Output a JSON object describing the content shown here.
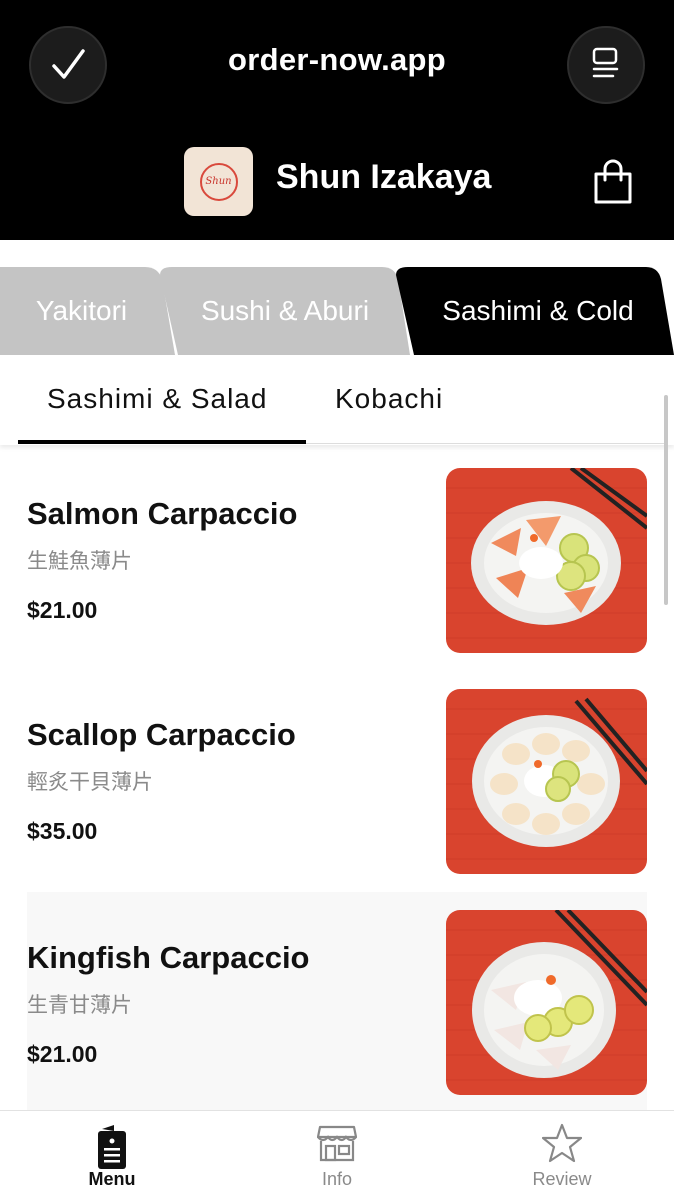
{
  "header": {
    "url": "order-now.app",
    "logo_text": "Shun",
    "store_name": "Shun Izakaya",
    "left_button_icon": "checkmark-icon",
    "right_button_icon": "menu-list-icon",
    "cart_icon": "shopping-bag-icon"
  },
  "categories": [
    {
      "label": "Yakitori",
      "active": false
    },
    {
      "label": "Sushi & Aburi",
      "active": false
    },
    {
      "label": "Sashimi & Cold",
      "active": true
    }
  ],
  "subtabs": [
    {
      "label": "Sashimi & Salad",
      "active": true
    },
    {
      "label": "Kobachi",
      "active": false
    }
  ],
  "items": [
    {
      "name": "Salmon Carpaccio",
      "subtitle": "生鮭魚薄片",
      "price": "$21.00"
    },
    {
      "name": "Scallop Carpaccio",
      "subtitle": "輕炙干貝薄片",
      "price": "$35.00"
    },
    {
      "name": "Kingfish Carpaccio",
      "subtitle": "生青甘薄片",
      "price": "$21.00"
    }
  ],
  "bottom_nav": [
    {
      "label": "Menu",
      "icon": "menu-book-icon",
      "active": true
    },
    {
      "label": "Info",
      "icon": "store-icon",
      "active": false
    },
    {
      "label": "Review",
      "icon": "star-icon",
      "active": false
    }
  ],
  "colors": {
    "header_bg": "#000000",
    "accent": "#000000",
    "inactive_tab": "#c4c4c4",
    "plate_bg": "#d9442e"
  }
}
